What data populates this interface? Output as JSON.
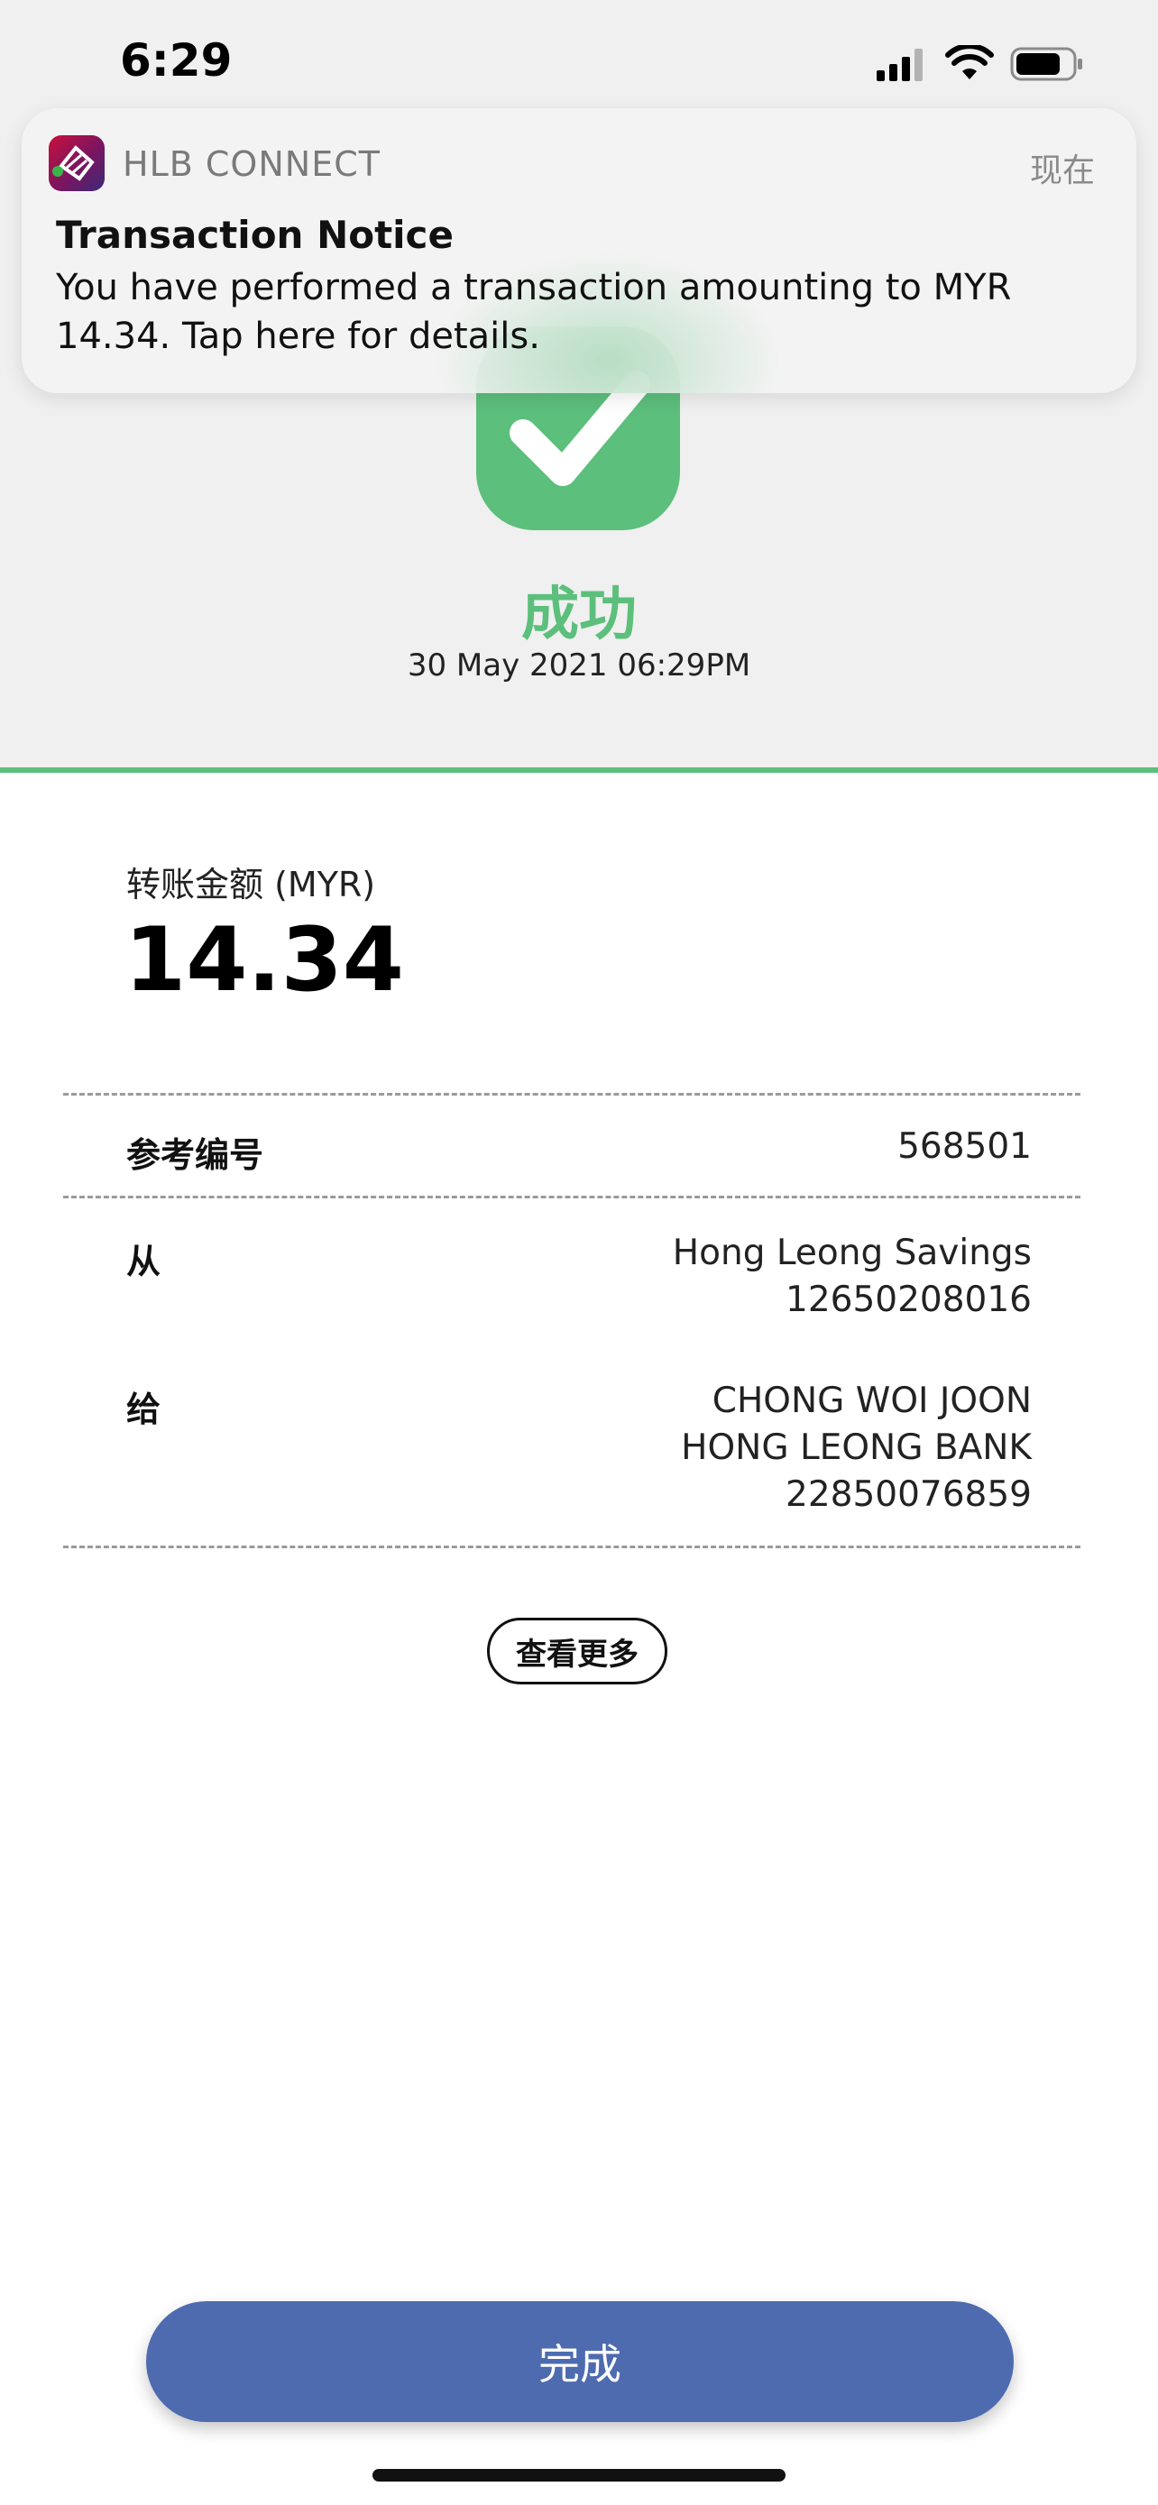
{
  "status_bar": {
    "time": "6:29",
    "icons": [
      "signal-icon",
      "wifi-icon",
      "battery-icon"
    ]
  },
  "notification": {
    "app_icon": "hlb-app-icon",
    "app_name": "HLB CONNECT",
    "time": "现在",
    "title": "Transaction Notice",
    "body": "You have performed a transaction amounting to MYR 14.34. Tap here for details."
  },
  "result": {
    "icon": "checkmark-icon",
    "status": "成功",
    "datetime": "30 May 2021 06:29PM"
  },
  "transfer": {
    "amount_label": "转账金额 (MYR)",
    "amount": "14.34"
  },
  "details": {
    "reference_label": "参考编号",
    "reference_value": "568501",
    "from_label": "从",
    "from_lines": [
      "Hong Leong Savings",
      "12650208016"
    ],
    "to_label": "给",
    "to_lines": [
      "CHONG WOI JOON",
      "HONG LEONG BANK",
      "22850076859"
    ]
  },
  "actions": {
    "more_label": "查看更多",
    "done_label": "完成"
  },
  "colors": {
    "success_green": "#5cbf7c",
    "primary_blue": "#4e6bb0",
    "background_grey": "#f0f0f0"
  }
}
